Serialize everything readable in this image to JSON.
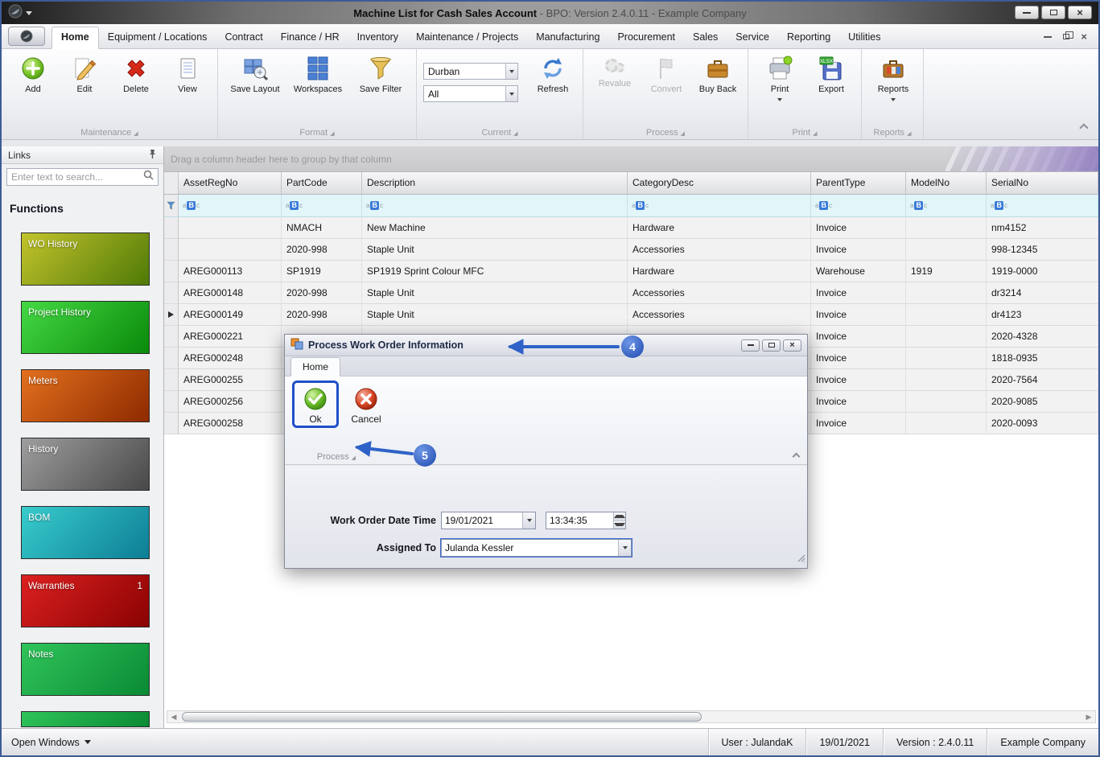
{
  "window": {
    "title_main": "Machine List for Cash Sales Account",
    "title_suffix": " - BPO: Version 2.4.0.11 - Example Company"
  },
  "tabs": {
    "items": [
      "Home",
      "Equipment / Locations",
      "Contract",
      "Finance / HR",
      "Inventory",
      "Maintenance / Projects",
      "Manufacturing",
      "Procurement",
      "Sales",
      "Service",
      "Reporting",
      "Utilities"
    ]
  },
  "ribbon": {
    "maintenance": {
      "caption": "Maintenance",
      "add": "Add",
      "edit": "Edit",
      "delete": "Delete",
      "view": "View"
    },
    "format": {
      "caption": "Format",
      "save_layout": "Save Layout",
      "workspaces": "Workspaces",
      "save_filter": "Save Filter"
    },
    "current": {
      "caption": "Current",
      "site": "Durban",
      "filter": "All",
      "refresh": "Refresh"
    },
    "process": {
      "caption": "Process",
      "revalue": "Revalue",
      "convert": "Convert",
      "buy_back": "Buy Back"
    },
    "print": {
      "caption": "Print",
      "print": "Print",
      "export": "Export",
      "export_icon_text": "XLSX"
    },
    "reports": {
      "caption": "Reports",
      "reports": "Reports"
    }
  },
  "sidebar": {
    "links_title": "Links",
    "search_placeholder": "Enter text to search...",
    "functions_title": "Functions",
    "tiles": [
      {
        "label": "WO History",
        "badge": "",
        "color1": "#c3c32c",
        "color2": "#4e7a06"
      },
      {
        "label": "Project History",
        "badge": "",
        "color1": "#44d844",
        "color2": "#0a8a0a"
      },
      {
        "label": "Meters",
        "badge": "",
        "color1": "#e2701e",
        "color2": "#8e2a00"
      },
      {
        "label": "History",
        "badge": "",
        "color1": "#9e9e9e",
        "color2": "#484848"
      },
      {
        "label": "BOM",
        "badge": "",
        "color1": "#38cccc",
        "color2": "#0d7e96"
      },
      {
        "label": "Warranties",
        "badge": "1",
        "color1": "#dc2020",
        "color2": "#8a0202"
      },
      {
        "label": "Notes",
        "badge": "",
        "color1": "#30c45a",
        "color2": "#0a8a34"
      }
    ]
  },
  "grid": {
    "group_hint": "Drag a column header here to group by that column",
    "columns": [
      "AssetRegNo",
      "PartCode",
      "Description",
      "CategoryDesc",
      "ParentType",
      "ModelNo",
      "SerialNo"
    ],
    "filter_badge": {
      "pre": "a",
      "mid": "B",
      "post": "c"
    },
    "rows": [
      [
        "",
        "NMACH",
        "New Machine",
        "Hardware",
        "Invoice",
        "",
        "nm4152"
      ],
      [
        "",
        "2020-998",
        "Staple Unit",
        "Accessories",
        "Invoice",
        "",
        "998-12345"
      ],
      [
        "AREG000113",
        "SP1919",
        "SP1919 Sprint Colour MFC",
        "Hardware",
        "Warehouse",
        "1919",
        "1919-0000"
      ],
      [
        "AREG000148",
        "2020-998",
        "Staple Unit",
        "Accessories",
        "Invoice",
        "",
        "dr3214"
      ],
      [
        "AREG000149",
        "2020-998",
        "Staple Unit",
        "Accessories",
        "Invoice",
        "",
        "dr4123"
      ],
      [
        "AREG000221",
        "",
        "",
        "",
        "Invoice",
        "",
        "2020-4328"
      ],
      [
        "AREG000248",
        "",
        "",
        "",
        "Invoice",
        "",
        "1818-0935"
      ],
      [
        "AREG000255",
        "",
        "",
        "",
        "Invoice",
        "",
        "2020-7564"
      ],
      [
        "AREG000256",
        "",
        "",
        "",
        "Invoice",
        "",
        "2020-9085"
      ],
      [
        "AREG000258",
        "",
        "",
        "",
        "Invoice",
        "",
        "2020-0093"
      ]
    ]
  },
  "dialog": {
    "title": "Process Work Order Information",
    "tab": "Home",
    "ok": "Ok",
    "cancel": "Cancel",
    "group": "Process",
    "fields": {
      "datetime_label": "Work Order Date Time",
      "date_value": "19/01/2021",
      "time_value": "13:34:35",
      "assigned_label": "Assigned To",
      "assigned_value": "Julanda Kessler"
    }
  },
  "annotations": {
    "step4": "4",
    "step5": "5",
    "accent": "#2e62c8"
  },
  "statusbar": {
    "open_windows": "Open Windows",
    "user": "User : JulandaK",
    "date": "19/01/2021",
    "version": "Version : 2.4.0.11",
    "company": "Example Company"
  }
}
